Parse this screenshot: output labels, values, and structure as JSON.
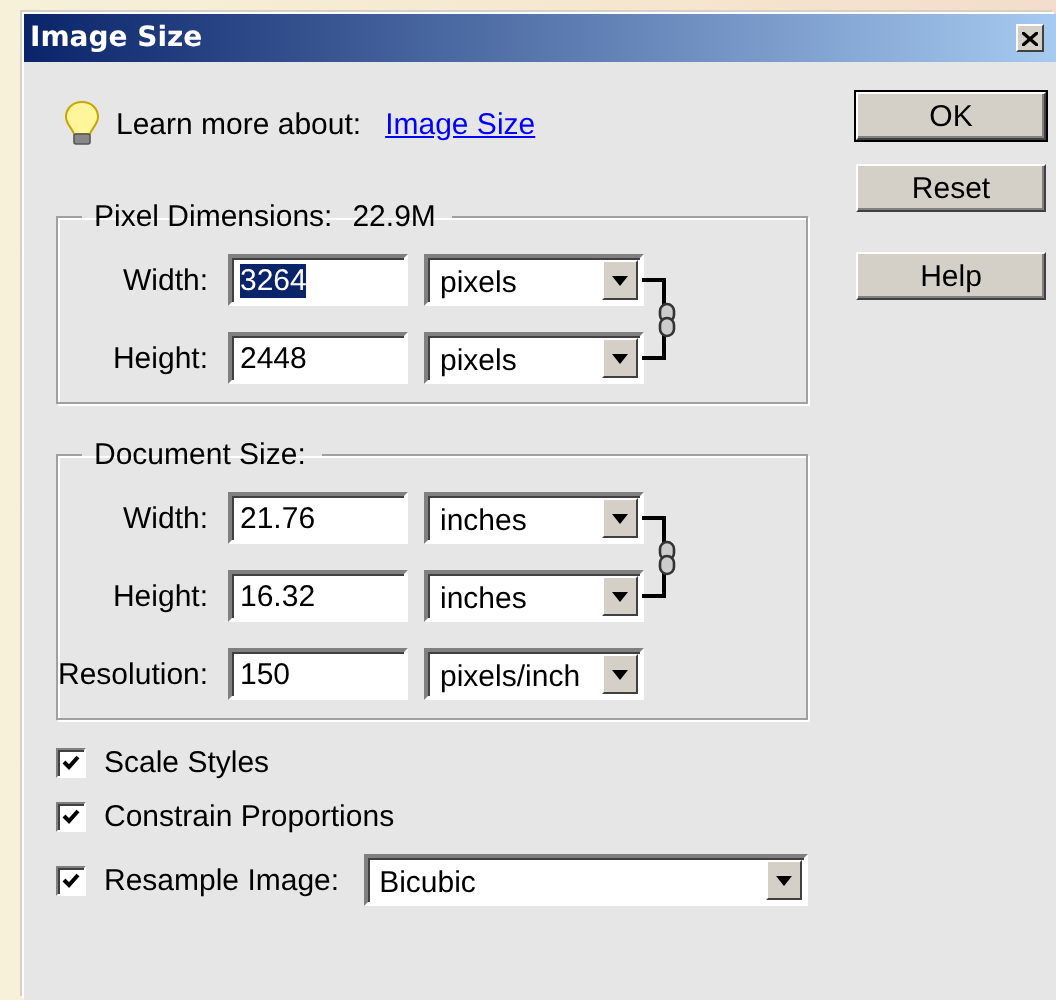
{
  "window": {
    "title": "Image Size"
  },
  "learn_more": {
    "label": "Learn more about:",
    "link": "Image Size"
  },
  "groups": [
    {
      "title": "Pixel Dimensions:",
      "value": "22.9M",
      "fields": [
        {
          "label": "Width:",
          "value": "3264",
          "selected": true,
          "unit": "pixels",
          "linked": true
        },
        {
          "label": "Height:",
          "value": "2448",
          "selected": false,
          "unit": "pixels",
          "linked": true
        }
      ]
    },
    {
      "title": "Document Size:",
      "fields": [
        {
          "label": "Width:",
          "value": "21.76",
          "selected": false,
          "unit": "inches",
          "linked": true
        },
        {
          "label": "Height:",
          "value": "16.32",
          "selected": false,
          "unit": "inches",
          "linked": true
        },
        {
          "label": "Resolution:",
          "value": "150",
          "selected": false,
          "unit": "pixels/inch",
          "linked": false
        }
      ]
    }
  ],
  "options": [
    {
      "kind": "checkbox",
      "label": "Scale Styles",
      "checked": true
    },
    {
      "kind": "checkbox",
      "label": "Constrain Proportions",
      "checked": true
    },
    {
      "kind": "select",
      "label": "Resample Image:",
      "checked": true,
      "value": "Bicubic"
    }
  ],
  "buttons": [
    {
      "label": "OK",
      "default": true
    },
    {
      "label": "Reset",
      "default": false
    },
    {
      "label": "Help",
      "default": false
    }
  ]
}
